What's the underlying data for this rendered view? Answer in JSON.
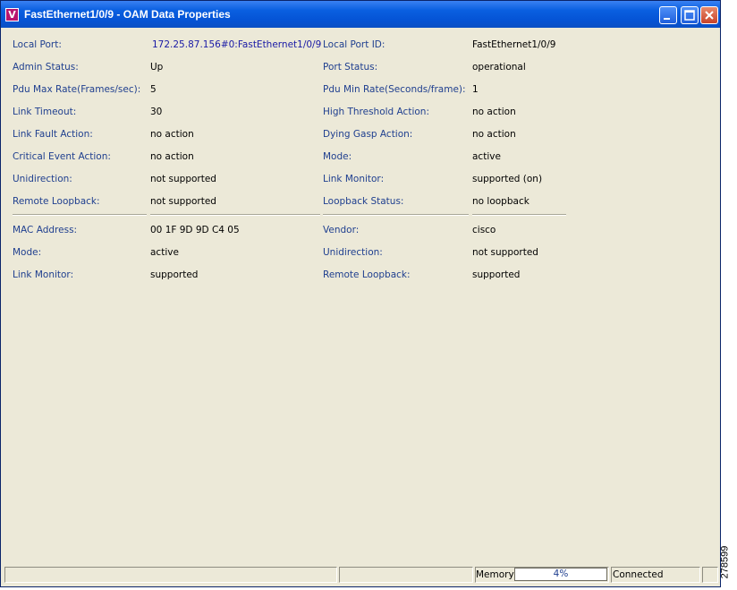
{
  "window": {
    "title": "FastEthernet1/0/9 - OAM Data Properties",
    "icon_letter": "V",
    "controls": [
      "minimize-icon",
      "maximize-icon",
      "close-icon"
    ]
  },
  "local": {
    "rows": [
      {
        "left_label": "Local Port:",
        "left_value": "172.25.87.156#0:FastEthernet1/0/9",
        "right_label": "Local Port ID:",
        "right_value": "FastEthernet1/0/9"
      },
      {
        "left_label": "Admin Status:",
        "left_value": "Up",
        "right_label": "Port Status:",
        "right_value": "operational"
      },
      {
        "left_label": "Pdu Max Rate(Frames/sec):",
        "left_value": "5",
        "right_label": "Pdu Min Rate(Seconds/frame):",
        "right_value": "1"
      },
      {
        "left_label": "Link Timeout:",
        "left_value": "30",
        "right_label": "High Threshold Action:",
        "right_value": "no action"
      },
      {
        "left_label": "Link Fault Action:",
        "left_value": "no action",
        "right_label": "Dying Gasp Action:",
        "right_value": "no action"
      },
      {
        "left_label": "Critical Event Action:",
        "left_value": "no action",
        "right_label": "Mode:",
        "right_value": "active"
      },
      {
        "left_label": "Unidirection:",
        "left_value": "not supported",
        "right_label": "Link Monitor:",
        "right_value": "supported (on)"
      },
      {
        "left_label": "Remote Loopback:",
        "left_value": "not supported",
        "right_label": "Loopback Status:",
        "right_value": "no loopback"
      }
    ]
  },
  "remote": {
    "rows": [
      {
        "left_label": "MAC Address:",
        "left_value": "00 1F 9D 9D C4 05",
        "right_label": "Vendor:",
        "right_value": "cisco"
      },
      {
        "left_label": "Mode:",
        "left_value": "active",
        "right_label": "Unidirection:",
        "right_value": "not supported"
      },
      {
        "left_label": "Link Monitor:",
        "left_value": "supported",
        "right_label": "Remote Loopback:",
        "right_value": "supported"
      }
    ]
  },
  "statusbar": {
    "memory_label": "Memory:",
    "memory_percent": "4%",
    "connection": "Connected"
  },
  "side_code": "278599",
  "colors": {
    "label": "#1f3f8f",
    "link_value": "#1a1aa6",
    "background": "#ece9d8",
    "titlebar": "#0554d6"
  }
}
